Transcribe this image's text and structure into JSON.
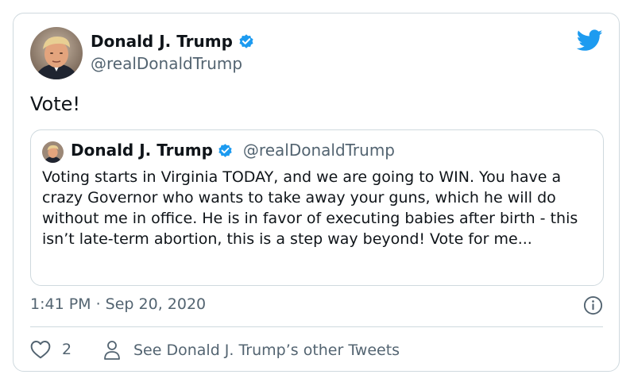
{
  "tweet": {
    "author": {
      "name": "Donald J. Trump",
      "handle": "@realDonaldTrump",
      "verified": true
    },
    "text": "Vote!",
    "timestamp": "1:41 PM · Sep 20, 2020",
    "likes": "2",
    "other_tweets_label": "See Donald J. Trump’s other Tweets"
  },
  "quoted_tweet": {
    "author": {
      "name": "Donald J. Trump",
      "handle": "@realDonaldTrump",
      "verified": true
    },
    "text": "Voting starts in Virginia TODAY, and we are going to WIN. You have a crazy Governor who wants to take away your guns, which he will do without me in office. He is in favor of executing babies after birth - this isn’t late-term abortion, this is a step way beyond! Vote for me..."
  },
  "icons": {
    "brand": "twitter-bird-icon",
    "verified": "verified-badge-icon",
    "info": "info-icon",
    "like": "heart-icon",
    "profile": "person-icon"
  },
  "colors": {
    "twitter_blue": "#1d9bf0",
    "secondary_text": "#536471",
    "border": "#cfd9de",
    "primary_text": "#0f1419"
  }
}
